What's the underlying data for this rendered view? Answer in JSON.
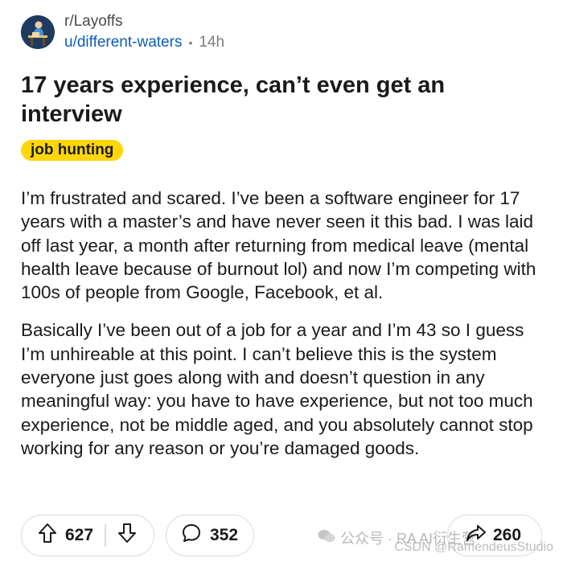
{
  "post": {
    "subreddit": "r/Layoffs",
    "username": "u/different-waters",
    "separator": "•",
    "time_ago": "14h",
    "title": "17 years experience, can’t even get an interview",
    "flair": "job hunting",
    "paragraphs": [
      "I’m frustrated and scared. I’ve been a software engineer for 17 years with a master’s and have never seen it this bad. I was laid off last year, a month after returning from medical leave (mental health leave because of burnout lol) and now I’m competing with 100s of people from Google, Facebook, et al.",
      "Basically I’ve been out of a job for a year and I’m 43 so I guess I’m unhireable at this point. I can’t believe this is the system everyone just goes along with and doesn’t question in any meaningful way: you have to have experience, but not too much experience, not be middle aged, and you absolutely cannot stop working for any reason or you’re damaged goods."
    ]
  },
  "actions": {
    "upvotes": "627",
    "comments": "352",
    "shares": "260"
  },
  "watermarks": {
    "wechat": "公众号 · RA AI衍生营",
    "csdn": "CSDN @RamendeusStudio"
  },
  "colors": {
    "flair_bg": "#ffd60a",
    "username": "#0b5fb5",
    "avatar_bg": "#1f3a5f"
  },
  "icons": [
    "avatar",
    "upvote-icon",
    "downvote-icon",
    "comment-icon",
    "share-icon",
    "wechat-icon"
  ]
}
